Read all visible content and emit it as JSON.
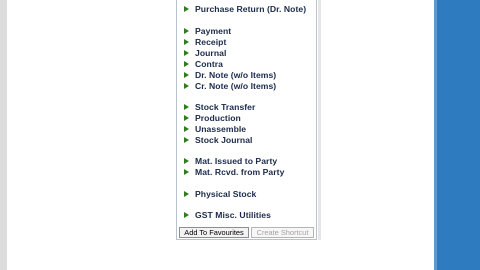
{
  "menu": {
    "items": [
      {
        "label": "Purchase Return (Dr. Note)"
      },
      {
        "label": "Payment"
      },
      {
        "label": "Receipt"
      },
      {
        "label": "Journal"
      },
      {
        "label": "Contra"
      },
      {
        "label": "Dr. Note (w/o Items)"
      },
      {
        "label": "Cr. Note (w/o Items)"
      },
      {
        "label": "Stock Transfer"
      },
      {
        "label": "Production"
      },
      {
        "label": "Unassemble"
      },
      {
        "label": "Stock Journal"
      },
      {
        "label": "Mat. Issued to Party"
      },
      {
        "label": "Mat. Rcvd. from Party"
      },
      {
        "label": "Physical Stock"
      },
      {
        "label": "GST Misc. Utilities"
      }
    ]
  },
  "footer": {
    "add_to_favourites": "Add To Favourites",
    "create_shortcut": "Create Shortcut"
  },
  "colors": {
    "arrow": "#2f7d1e",
    "menu_text": "#1b2a4a",
    "background_band": "#2f7bbf"
  },
  "icons": {
    "item_bullet": "green-triangle-arrow-icon"
  }
}
